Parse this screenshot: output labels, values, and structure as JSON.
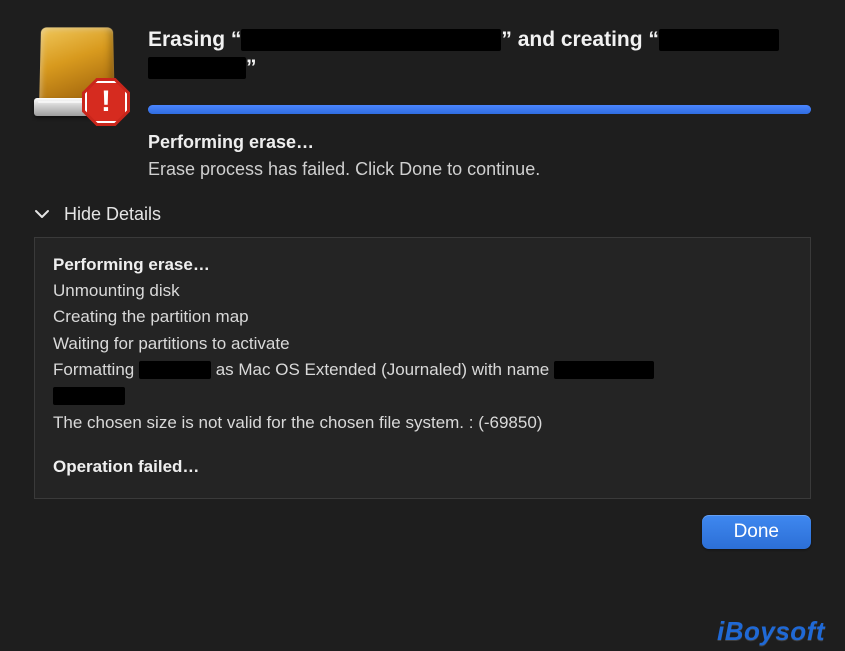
{
  "header": {
    "title_prefix": "Erasing “",
    "title_mid": "” and creating “",
    "title_suffix": "”"
  },
  "progress": {
    "percent": 100
  },
  "status": {
    "heading": "Performing erase…",
    "message": "Erase process has failed. Click Done to continue."
  },
  "details": {
    "toggle_label": "Hide Details",
    "log": {
      "l0": "Performing erase…",
      "l1": "Unmounting disk",
      "l2": "Creating the partition map",
      "l3": "Waiting for partitions to activate",
      "l4a": "Formatting ",
      "l4b": " as Mac OS Extended (Journaled) with name ",
      "l5": "The chosen size is not valid for the chosen file system. : (-69850)",
      "l6": "Operation failed…"
    }
  },
  "buttons": {
    "done": "Done"
  },
  "watermark": "iBoysoft"
}
